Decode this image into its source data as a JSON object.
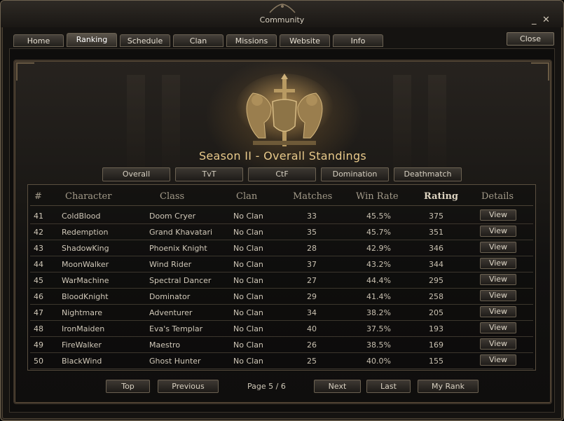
{
  "window": {
    "title": "Community",
    "minimize_glyph": "_",
    "close_glyph": "✕"
  },
  "tabs": [
    {
      "label": "Home"
    },
    {
      "label": "Ranking"
    },
    {
      "label": "Schedule"
    },
    {
      "label": "Clan"
    },
    {
      "label": "Missions"
    },
    {
      "label": "Website"
    },
    {
      "label": "Info"
    }
  ],
  "active_tab": "Ranking",
  "close_button": "Close",
  "season_title": "Season II - Overall Standings",
  "filters": [
    {
      "label": "Overall"
    },
    {
      "label": "TvT"
    },
    {
      "label": "CtF"
    },
    {
      "label": "Domination"
    },
    {
      "label": "Deathmatch"
    }
  ],
  "columns": [
    "#",
    "Character",
    "Class",
    "Clan",
    "Matches",
    "Win Rate",
    "Rating",
    "Details"
  ],
  "rows": [
    {
      "rank": "41",
      "character": "ColdBlood",
      "class": "Doom Cryer",
      "clan": "No Clan",
      "matches": "33",
      "win_rate": "45.5%",
      "rating": "375",
      "details": "View"
    },
    {
      "rank": "42",
      "character": "Redemption",
      "class": "Grand Khavatari",
      "clan": "No Clan",
      "matches": "35",
      "win_rate": "45.7%",
      "rating": "351",
      "details": "View"
    },
    {
      "rank": "43",
      "character": "ShadowKing",
      "class": "Phoenix Knight",
      "clan": "No Clan",
      "matches": "28",
      "win_rate": "42.9%",
      "rating": "346",
      "details": "View"
    },
    {
      "rank": "44",
      "character": "MoonWalker",
      "class": "Wind Rider",
      "clan": "No Clan",
      "matches": "37",
      "win_rate": "43.2%",
      "rating": "344",
      "details": "View"
    },
    {
      "rank": "45",
      "character": "WarMachine",
      "class": "Spectral Dancer",
      "clan": "No Clan",
      "matches": "27",
      "win_rate": "44.4%",
      "rating": "295",
      "details": "View"
    },
    {
      "rank": "46",
      "character": "BloodKnight",
      "class": "Dominator",
      "clan": "No Clan",
      "matches": "29",
      "win_rate": "41.4%",
      "rating": "258",
      "details": "View"
    },
    {
      "rank": "47",
      "character": "Nightmare",
      "class": "Adventurer",
      "clan": "No Clan",
      "matches": "34",
      "win_rate": "38.2%",
      "rating": "205",
      "details": "View"
    },
    {
      "rank": "48",
      "character": "IronMaiden",
      "class": "Eva's Templar",
      "clan": "No Clan",
      "matches": "40",
      "win_rate": "37.5%",
      "rating": "193",
      "details": "View"
    },
    {
      "rank": "49",
      "character": "FireWalker",
      "class": "Maestro",
      "clan": "No Clan",
      "matches": "26",
      "win_rate": "38.5%",
      "rating": "169",
      "details": "View"
    },
    {
      "rank": "50",
      "character": "BlackWind",
      "class": "Ghost Hunter",
      "clan": "No Clan",
      "matches": "25",
      "win_rate": "40.0%",
      "rating": "155",
      "details": "View"
    }
  ],
  "pagination": {
    "top": "Top",
    "previous": "Previous",
    "page_label": "Page 5 / 6",
    "next": "Next",
    "last": "Last",
    "my_rank": "My Rank"
  },
  "icons": {
    "emblem": "twin-lions-sword-crest-icon"
  },
  "colors": {
    "accent_gold": "#e8c98a",
    "text": "#d0c8b8"
  }
}
